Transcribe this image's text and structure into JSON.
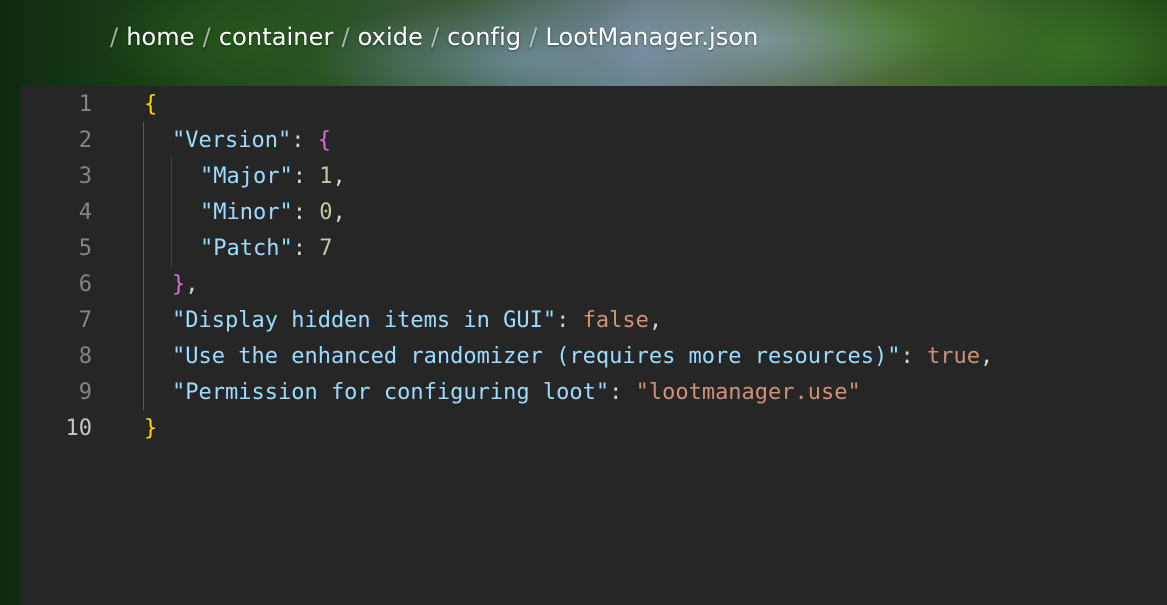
{
  "breadcrumb": {
    "separator": "/",
    "items": [
      "home",
      "container",
      "oxide",
      "config",
      "LootManager.json"
    ]
  },
  "editor": {
    "active_line": 10,
    "lines": [
      {
        "number": "1",
        "open_brace": "{"
      },
      {
        "number": "2",
        "key": "\"Version\"",
        "colon": ": ",
        "open_brace": "{"
      },
      {
        "number": "3",
        "key": "\"Major\"",
        "colon": ": ",
        "value": "1",
        "comma": ","
      },
      {
        "number": "4",
        "key": "\"Minor\"",
        "colon": ": ",
        "value": "0",
        "comma": ","
      },
      {
        "number": "5",
        "key": "\"Patch\"",
        "colon": ": ",
        "value": "7"
      },
      {
        "number": "6",
        "close_brace": "}",
        "comma": ","
      },
      {
        "number": "7",
        "key": "\"Display hidden items in GUI\"",
        "colon": ": ",
        "value": "false",
        "comma": ","
      },
      {
        "number": "8",
        "key": "\"Use the enhanced randomizer (requires more resources)\"",
        "colon": ": ",
        "value": "true",
        "comma": ","
      },
      {
        "number": "9",
        "key": "\"Permission for configuring loot\"",
        "colon": ": ",
        "value": "\"lootmanager.use\""
      },
      {
        "number": "10",
        "close_brace": "}"
      }
    ]
  },
  "colors": {
    "editor_background": "#262627",
    "line_number": "#858585",
    "active_line_number": "#c6c6c6",
    "json_key": "#9cdcfe",
    "json_number": "#b5cea8",
    "json_boolean_string": "#ce9178",
    "bracket_level_1": "#ffd700",
    "bracket_level_2": "#da70d6"
  }
}
